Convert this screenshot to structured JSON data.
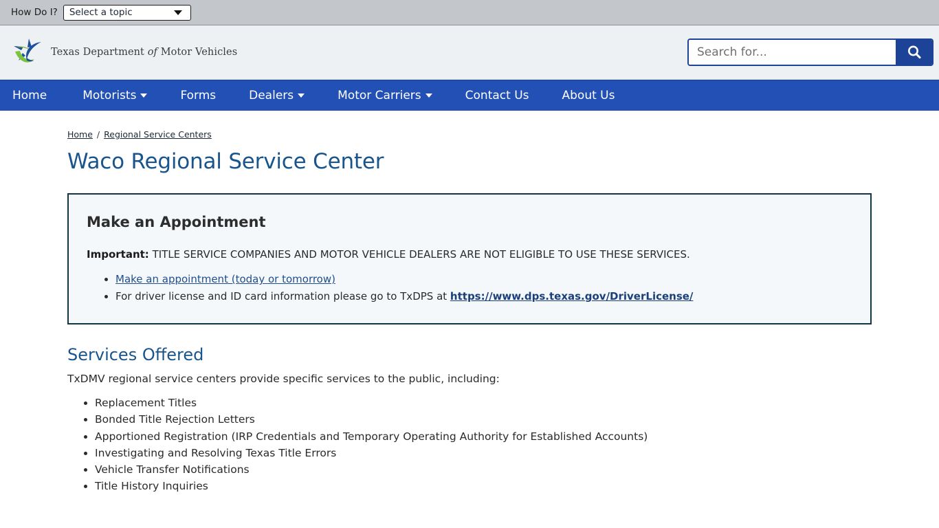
{
  "topbar": {
    "label": "How Do I?",
    "select_value": "Select a topic",
    "caret_icon": "chevron-down-icon"
  },
  "masthead": {
    "brand_line1": "Texas Department ",
    "brand_of": "of",
    "brand_line2": " Motor Vehicles",
    "logo_icon": "txdmv-star-swoosh-logo",
    "search": {
      "placeholder": "Search for...",
      "value": "",
      "button_icon": "search-icon"
    }
  },
  "nav": {
    "items": [
      {
        "label": "Home",
        "has_caret": false
      },
      {
        "label": "Motorists",
        "has_caret": true
      },
      {
        "label": "Forms",
        "has_caret": false
      },
      {
        "label": "Dealers",
        "has_caret": true
      },
      {
        "label": "Motor Carriers",
        "has_caret": true
      },
      {
        "label": "Contact Us",
        "has_caret": false
      },
      {
        "label": "About Us",
        "has_caret": false
      }
    ]
  },
  "breadcrumb": {
    "home": "Home",
    "separator": "/",
    "current": "Regional Service Centers"
  },
  "page": {
    "title": "Waco Regional Service Center"
  },
  "appointment_box": {
    "heading": "Make an Appointment",
    "important_label": "Important:",
    "important_text": " TITLE SERVICE COMPANIES AND MOTOR VEHICLE DEALERS ARE NOT ELIGIBLE TO USE THESE SERVICES.",
    "bullet1_link": "Make an appointment (today or tomorrow)",
    "bullet2_text": "For driver license and ID card information please go to TxDPS at ",
    "bullet2_link": "https://www.dps.texas.gov/DriverLicense/"
  },
  "services": {
    "heading": "Services Offered",
    "intro": "TxDMV regional service centers provide specific services to the public, including:",
    "items": [
      "Replacement Titles",
      "Bonded Title Rejection Letters",
      "Apportioned Registration (IRP Credentials and Temporary Operating Authority for Established Accounts)",
      "Investigating and Resolving Texas Title Errors",
      "Vehicle Transfer Notifications",
      "Title History Inquiries"
    ]
  },
  "colors": {
    "nav_blue": "#2250b4",
    "search_blue": "#1c4397",
    "heading_blue": "#19558c",
    "topbar_gray": "#c3c7cb",
    "masthead_gray": "#eef1f4",
    "box_bg": "#f4f8fb",
    "box_border": "#123447"
  }
}
